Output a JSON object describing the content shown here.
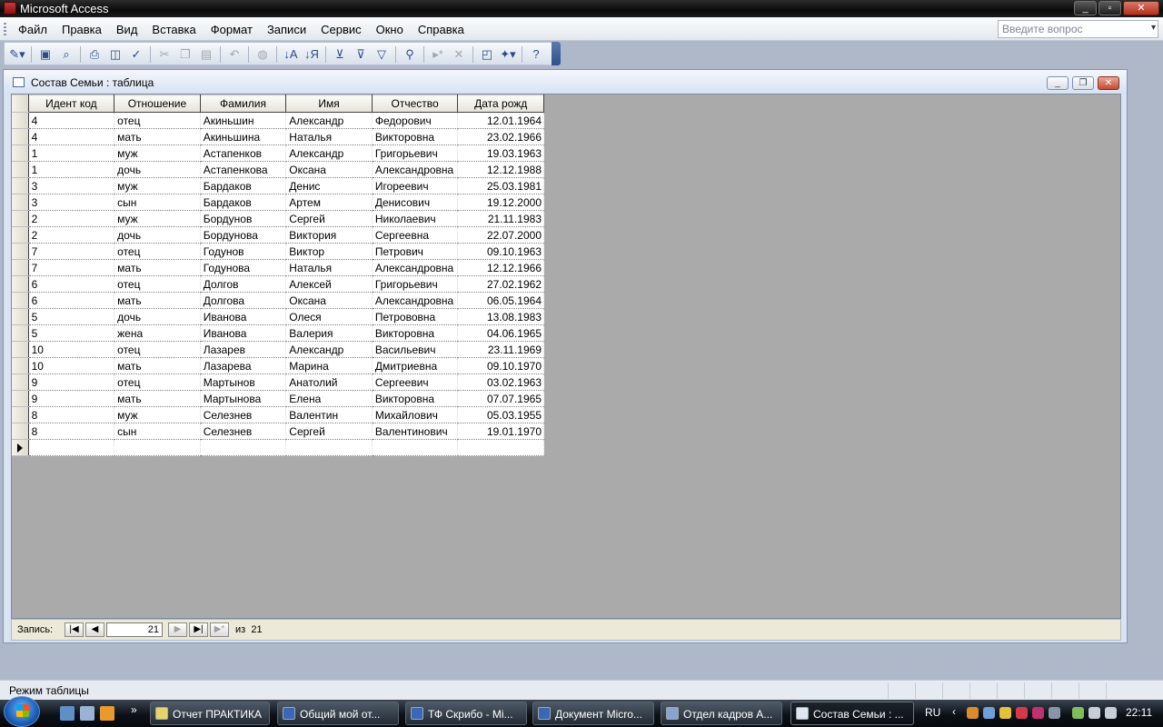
{
  "app": {
    "title": "Microsoft Access"
  },
  "menu": {
    "items": [
      "Файл",
      "Правка",
      "Вид",
      "Вставка",
      "Формат",
      "Записи",
      "Сервис",
      "Окно",
      "Справка"
    ],
    "help_placeholder": "Введите вопрос"
  },
  "toolbar": {
    "icons": [
      "view-icon",
      "save-icon",
      "file-search-icon",
      "print-icon",
      "print-preview-icon",
      "spelling-icon",
      "cut-icon",
      "copy-icon",
      "paste-icon",
      "undo-icon",
      "hyperlink-icon",
      "sort-ascending-icon",
      "sort-descending-icon",
      "filter-by-selection-icon",
      "filter-by-form-icon",
      "apply-filter-icon",
      "find-icon",
      "new-record-icon",
      "delete-record-icon",
      "database-window-icon",
      "new-object-icon",
      "help-icon"
    ]
  },
  "window": {
    "title": "Состав Семьи : таблица"
  },
  "table": {
    "columns": [
      "Идент код",
      "Отношение",
      "Фамилия",
      "Имя",
      "Отчество",
      "Дата рожд"
    ],
    "rows": [
      [
        "4",
        "отец",
        "Акиньшин",
        "Александр",
        "Федорович",
        "12.01.1964"
      ],
      [
        "4",
        "мать",
        "Акиньшина",
        "Наталья",
        "Викторовна",
        "23.02.1966"
      ],
      [
        "1",
        "муж",
        "Астапенков",
        "Александр",
        "Григорьевич",
        "19.03.1963"
      ],
      [
        "1",
        "дочь",
        "Астапенкова",
        "Оксана",
        "Александровна",
        "12.12.1988"
      ],
      [
        "3",
        "муж",
        "Бардаков",
        "Денис",
        "Игореевич",
        "25.03.1981"
      ],
      [
        "3",
        "сын",
        "Бардаков",
        "Артем",
        "Денисович",
        "19.12.2000"
      ],
      [
        "2",
        "муж",
        "Бордунов",
        "Сергей",
        "Николаевич",
        "21.11.1983"
      ],
      [
        "2",
        "дочь",
        "Бордунова",
        "Виктория",
        "Сергеевна",
        "22.07.2000"
      ],
      [
        "7",
        "отец",
        "Годунов",
        "Виктор",
        "Петрович",
        "09.10.1963"
      ],
      [
        "7",
        "мать",
        "Годунова",
        "Наталья",
        "Александровна",
        "12.12.1966"
      ],
      [
        "6",
        "отец",
        "Долгов",
        "Алексей",
        "Григорьевич",
        "27.02.1962"
      ],
      [
        "6",
        "мать",
        "Долгова",
        "Оксана",
        "Александровна",
        "06.05.1964"
      ],
      [
        "5",
        "дочь",
        "Иванова",
        "Олеся",
        "Петрововна",
        "13.08.1983"
      ],
      [
        "5",
        "жена",
        "Иванова",
        "Валерия",
        "Викторовна",
        "04.06.1965"
      ],
      [
        "10",
        "отец",
        "Лазарев",
        "Александр",
        "Васильевич",
        "23.11.1969"
      ],
      [
        "10",
        "мать",
        "Лазарева",
        "Марина",
        "Дмитриевна",
        "09.10.1970"
      ],
      [
        "9",
        "отец",
        "Мартынов",
        "Анатолий",
        "Сергеевич",
        "03.02.1963"
      ],
      [
        "9",
        "мать",
        "Мартынова",
        "Елена",
        "Викторовна",
        "07.07.1965"
      ],
      [
        "8",
        "муж",
        "Селезнев",
        "Валентин",
        "Михайлович",
        "05.03.1955"
      ],
      [
        "8",
        "сын",
        "Селезнев",
        "Сергей",
        "Валентинович",
        "19.01.1970"
      ]
    ]
  },
  "record_nav": {
    "label": "Запись:",
    "current": "21",
    "of_label": "из",
    "total": "21"
  },
  "status": {
    "text": "Режим таблицы"
  },
  "taskbar": {
    "tasks": [
      {
        "label": "Отчет ПРАКТИКА",
        "active": false
      },
      {
        "label": "Общий мой от...",
        "active": false
      },
      {
        "label": "ТФ Скрибо - Mi...",
        "active": false
      },
      {
        "label": "Документ Micro...",
        "active": false
      },
      {
        "label": "Отдел кадров A...",
        "active": false
      },
      {
        "label": "Состав Семьи : ...",
        "active": true
      }
    ],
    "language": "RU",
    "clock": "22:11"
  },
  "colors": {
    "accent": "#2f4f86",
    "datasheet_bg": "#aaaaaa",
    "window_bg": "#d9e3f2"
  }
}
